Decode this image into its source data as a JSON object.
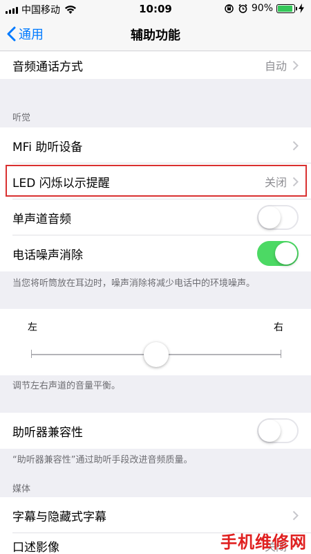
{
  "status_bar": {
    "carrier": "中国移动",
    "time": "10:09",
    "battery": "90%",
    "battery_level": 0.9
  },
  "nav": {
    "back_label": "通用",
    "title": "辅助功能"
  },
  "rows": {
    "audio_routing": {
      "label": "音频通话方式",
      "value": "自动"
    },
    "mfi": {
      "label": "MFi 助听设备"
    },
    "led_flash": {
      "label": "LED 闪烁以示提醒",
      "value": "关闭"
    },
    "mono_audio": {
      "label": "单声道音频",
      "on": false
    },
    "noise_cancel": {
      "label": "电话噪声消除",
      "on": true
    },
    "hac": {
      "label": "助听器兼容性",
      "on": false
    },
    "subtitles": {
      "label": "字幕与隐藏式字幕"
    },
    "audio_desc": {
      "label": "口述影像",
      "value": "关闭"
    }
  },
  "sections": {
    "hearing": "听觉",
    "media": "媒体"
  },
  "footers": {
    "noise": "当您将听筒放在耳边时，噪声消除将减少电话中的环境噪声。",
    "balance": "调节左右声道的音量平衡。",
    "hac": "“助听器兼容性”通过助听手段改进音频质量。"
  },
  "balance": {
    "left": "左",
    "right": "右",
    "value": 0.5
  },
  "watermark": "手机维修网",
  "colors": {
    "accent": "#007aff",
    "toggle_on": "#4cd964",
    "highlight": "#d93030"
  }
}
